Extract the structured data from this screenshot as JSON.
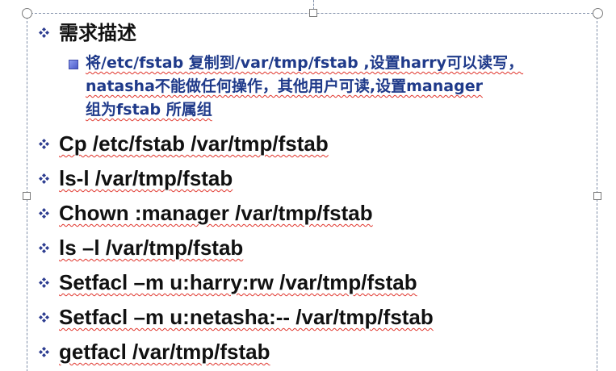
{
  "slide": {
    "heading": "需求描述",
    "requirement_lines": [
      "将/etc/fstab 复制到/var/tmp/fstab ,设置harry可以读写，",
      "natasha不能做任何操作，其他用户可读,设置manager",
      "组为fstab 所属组"
    ],
    "commands": [
      "Cp /etc/fstab  /var/tmp/fstab",
      "ls-l /var/tmp/fstab",
      "Chown :manager /var/tmp/fstab",
      "ls –l  /var/tmp/fstab",
      "Setfacl –m u:harry:rw /var/tmp/fstab",
      "Setfacl –m u:netasha:-- /var/tmp/fstab",
      "getfacl /var/tmp/fstab"
    ]
  },
  "colors": {
    "heading_text": "#111111",
    "requirement_text": "#1f3a8a",
    "bullet_diamond": "#2b3b8f",
    "sub_bullet": "#5c6fd0",
    "frame_border": "#7f8ea8",
    "spellcheck_underline": "#e0342b"
  },
  "icons": {
    "item_bullet": "diamond-bullet-icon",
    "sub_bullet": "square-bullet-icon",
    "handles": [
      "resize-handle-circle",
      "resize-handle-square",
      "rotate-handle"
    ]
  }
}
